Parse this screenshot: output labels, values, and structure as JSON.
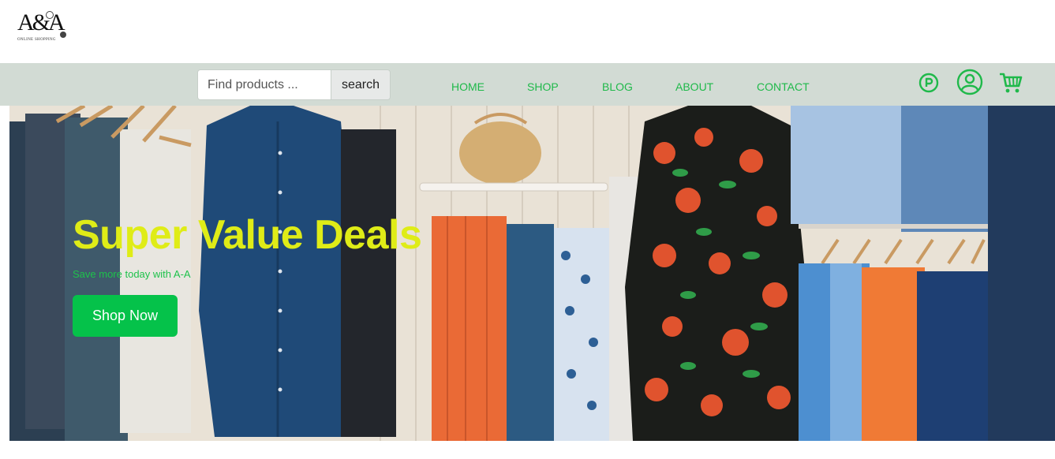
{
  "brand": {
    "logo_text": "A&A",
    "logo_subtitle": "ONLINE SHOPPING"
  },
  "search": {
    "placeholder": "Find products ...",
    "button_label": "search"
  },
  "nav": {
    "items": [
      {
        "label": "HOME"
      },
      {
        "label": "SHOP"
      },
      {
        "label": "BLOG"
      },
      {
        "label": "ABOUT"
      },
      {
        "label": "CONTACT"
      }
    ]
  },
  "icons": {
    "points": "p-circle-icon",
    "account": "user-circle-icon",
    "cart": "cart-icon",
    "accent_color": "#1fb94a"
  },
  "hero": {
    "title": "Super Value Deals",
    "subtitle": "Save more today with A-A",
    "cta_label": "Shop Now",
    "title_color": "#dfec17",
    "cta_color": "#05c24a"
  }
}
